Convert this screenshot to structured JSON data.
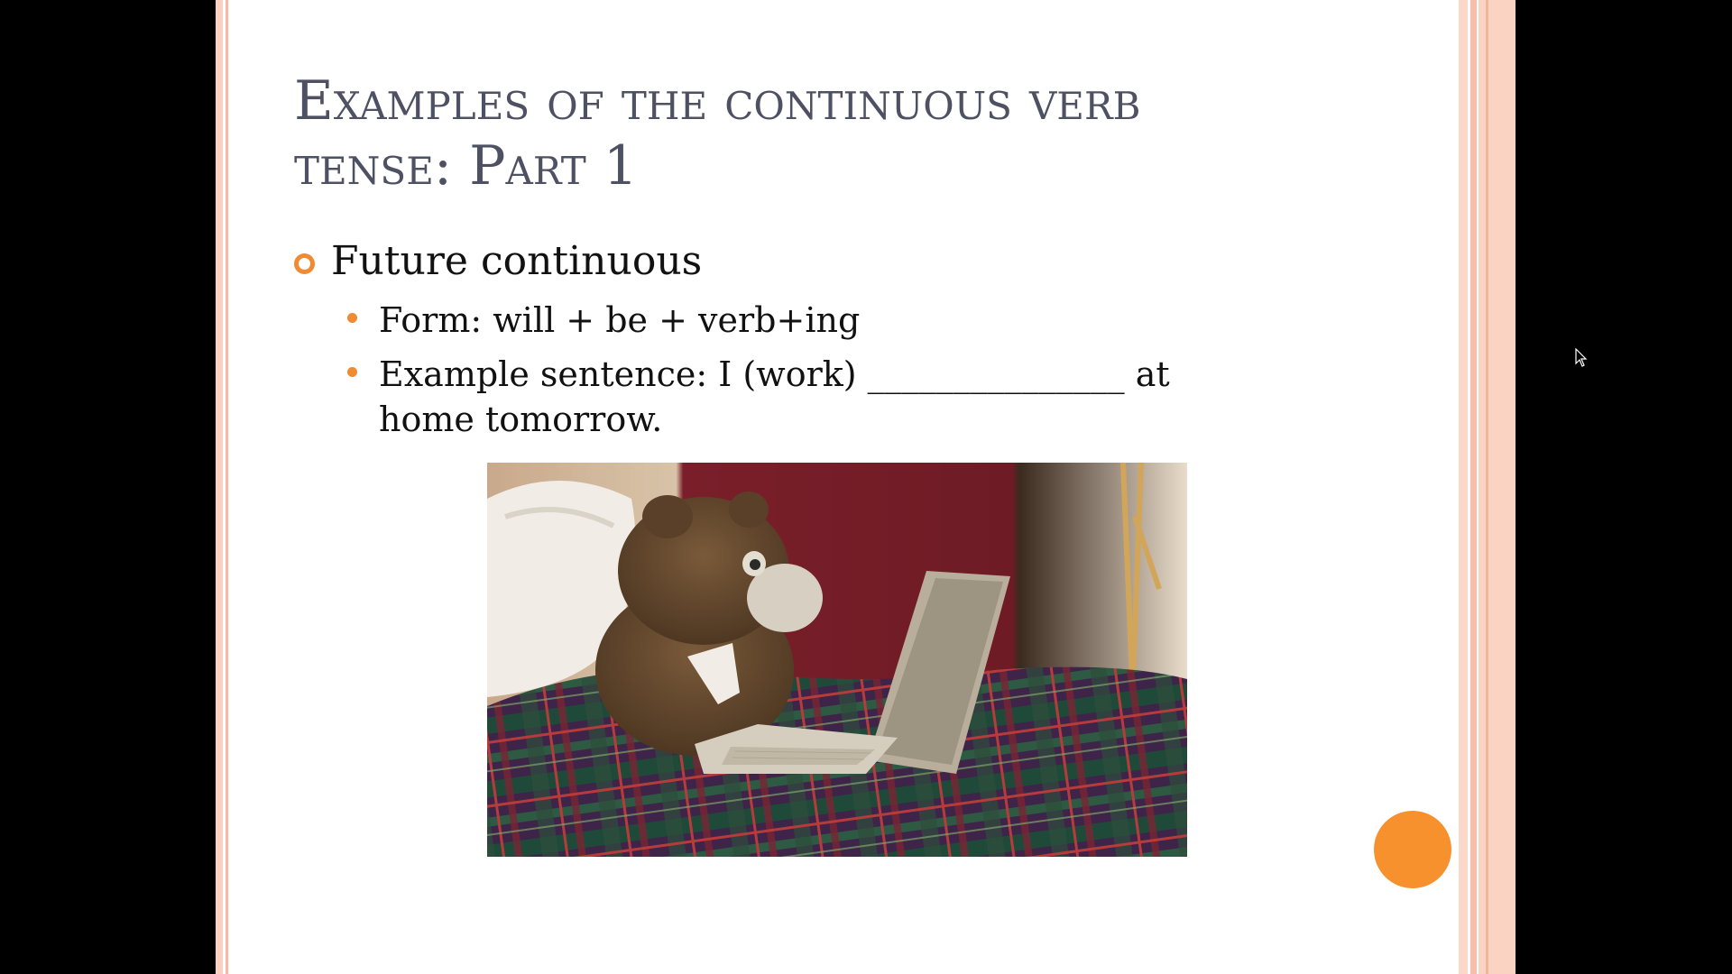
{
  "slide": {
    "title": "Examples of the continuous verb tense: Part 1",
    "bullets": [
      {
        "text": "Future continuous",
        "sub": [
          {
            "text": "Form: will + be + verb+ing"
          },
          {
            "text": "Example sentence: I (work) _______________ at home tomorrow."
          }
        ]
      }
    ]
  },
  "image": {
    "description": "teddy-bear-with-laptop-photo"
  },
  "colors": {
    "accent": "#f08a33",
    "title": "#4e5163",
    "stripe": "#fbd2c1",
    "background": "#000000"
  }
}
